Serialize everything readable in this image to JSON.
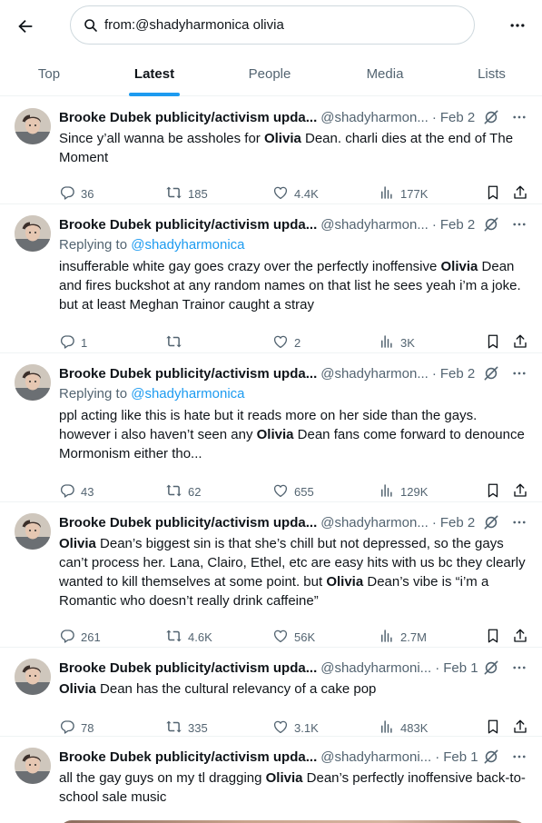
{
  "search": {
    "query": "from:@shadyharmonica olivia"
  },
  "tabs": [
    {
      "label": "Top"
    },
    {
      "label": "Latest"
    },
    {
      "label": "People"
    },
    {
      "label": "Media"
    },
    {
      "label": "Lists"
    }
  ],
  "active_tab": "Latest",
  "colors": {
    "accent": "#1d9bf0",
    "secondary_text": "#536471",
    "divider": "#eff3f4"
  },
  "tweets": [
    {
      "name": "Brooke Dubek publicity/activism upda...",
      "handle": "@shadyharmon...",
      "time": "Feb 2",
      "reply_prefix": "",
      "reply_handle": "",
      "segments": [
        {
          "t": "Since y’all wanna be assholes for "
        },
        {
          "t": "Olivia",
          "b": true
        },
        {
          "t": " Dean. charli dies at the end of The Moment"
        }
      ],
      "replies": "36",
      "reposts": "185",
      "likes": "4.4K",
      "views": "177K"
    },
    {
      "name": "Brooke Dubek publicity/activism upda...",
      "handle": "@shadyharmon...",
      "time": "Feb 2",
      "reply_prefix": "Replying to ",
      "reply_handle": "@shadyharmonica",
      "segments": [
        {
          "t": "insufferable white gay goes crazy over the perfectly inoffensive "
        },
        {
          "t": "Olivia",
          "b": true
        },
        {
          "t": " Dean and fires buckshot at any random names on that list he sees yeah i’m a joke. but at least Meghan Trainor caught a stray"
        }
      ],
      "replies": "1",
      "reposts": "",
      "likes": "2",
      "views": "3K"
    },
    {
      "name": "Brooke Dubek publicity/activism upda...",
      "handle": "@shadyharmon...",
      "time": "Feb 2",
      "reply_prefix": "Replying to ",
      "reply_handle": "@shadyharmonica",
      "segments": [
        {
          "t": "ppl acting like this is hate but it reads more on her side than the gays. however i also haven’t seen any "
        },
        {
          "t": "Olivia",
          "b": true
        },
        {
          "t": " Dean fans come forward to denounce Mormonism either tho..."
        }
      ],
      "replies": "43",
      "reposts": "62",
      "likes": "655",
      "views": "129K"
    },
    {
      "name": "Brooke Dubek publicity/activism upda...",
      "handle": "@shadyharmon...",
      "time": "Feb 2",
      "reply_prefix": "",
      "reply_handle": "",
      "segments": [
        {
          "t": "Olivia",
          "b": true
        },
        {
          "t": " Dean’s biggest sin is that she’s chill but not depressed, so the gays can’t process her. Lana, Clairo, Ethel, etc are easy hits with us bc they clearly wanted to kill themselves at some point. but "
        },
        {
          "t": "Olivia",
          "b": true
        },
        {
          "t": " Dean’s vibe is “i’m a Romantic who doesn’t really drink caffeine”"
        }
      ],
      "replies": "261",
      "reposts": "4.6K",
      "likes": "56K",
      "views": "2.7M"
    },
    {
      "name": "Brooke Dubek publicity/activism upda...",
      "handle": "@shadyharmoni...",
      "time": "Feb 1",
      "reply_prefix": "",
      "reply_handle": "",
      "segments": [
        {
          "t": "Olivia",
          "b": true
        },
        {
          "t": " Dean has the cultural relevancy of a cake pop"
        }
      ],
      "replies": "78",
      "reposts": "335",
      "likes": "3.1K",
      "views": "483K"
    },
    {
      "name": "Brooke Dubek publicity/activism upda...",
      "handle": "@shadyharmoni...",
      "time": "Feb 1",
      "reply_prefix": "",
      "reply_handle": "",
      "segments": [
        {
          "t": "all the gay guys on my tl dragging "
        },
        {
          "t": "Olivia",
          "b": true
        },
        {
          "t": " Dean’s perfectly inoffensive back-to-school sale music"
        }
      ],
      "replies": "",
      "reposts": "",
      "likes": "",
      "views": ""
    }
  ]
}
